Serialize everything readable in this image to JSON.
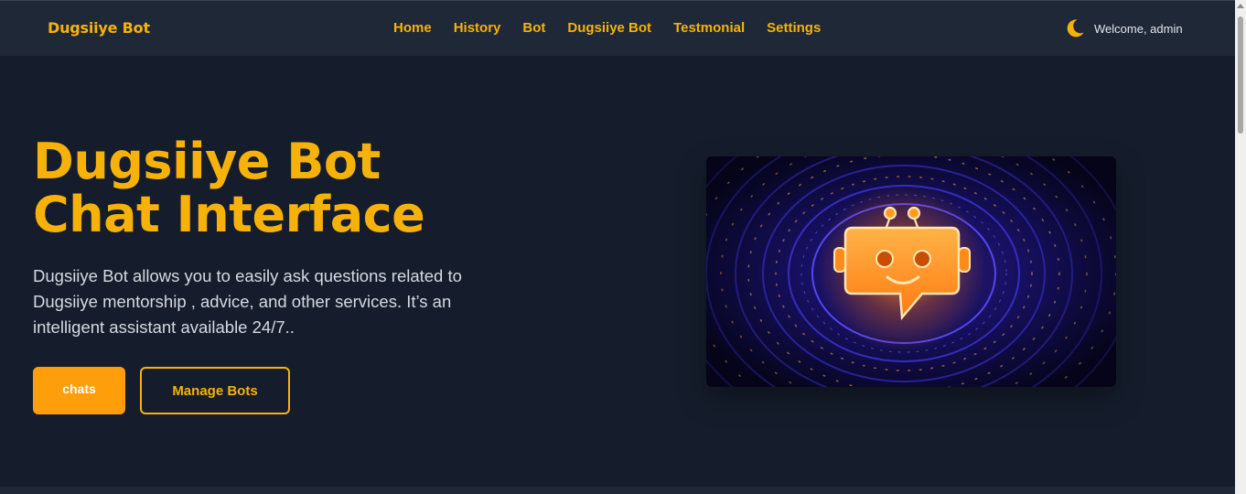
{
  "navbar": {
    "brand": "Dugsiiye Bot",
    "links": [
      "Home",
      "History",
      "Bot",
      "Dugsiiye Bot",
      "Testmonial",
      "Settings"
    ],
    "theme_icon": "moon-icon",
    "welcome": "Welcome, admin"
  },
  "hero": {
    "title_line1": "Dugsiiye Bot",
    "title_line2": "Chat Interface",
    "description": "Dugsiiye Bot allows you to easily ask questions related to Dugsiiye mentorship , advice, and other services. It’s an intelligent assistant available 24/7..",
    "primary_button": "chats",
    "secondary_button": "Manage Bots",
    "image_icon": "robot-chat-icon"
  },
  "colors": {
    "background": "#151d2c",
    "navbar": "#1e2837",
    "accent": "#f7b20a",
    "button": "#ff9e0b"
  }
}
